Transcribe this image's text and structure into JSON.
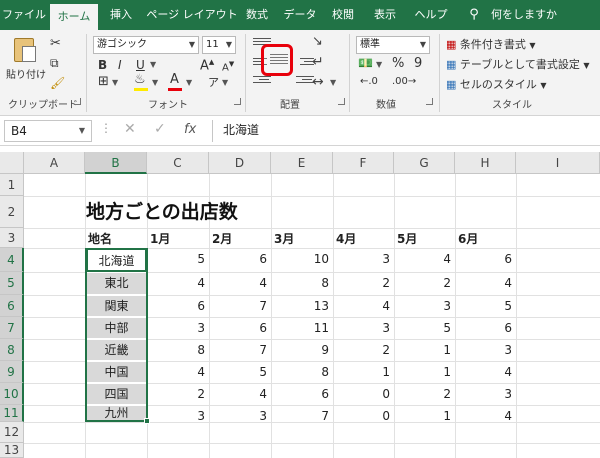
{
  "tabs": [
    {
      "label": "ファイル",
      "active": false
    },
    {
      "label": "ホーム",
      "active": true
    },
    {
      "label": "挿入",
      "active": false
    },
    {
      "label": "ページ レイアウト",
      "active": false
    },
    {
      "label": "数式",
      "active": false
    },
    {
      "label": "データ",
      "active": false
    },
    {
      "label": "校閲",
      "active": false
    },
    {
      "label": "表示",
      "active": false
    },
    {
      "label": "ヘルプ",
      "active": false
    }
  ],
  "tellme": "何をしますか",
  "ribbon": {
    "clipboard": {
      "label": "クリップボード",
      "paste_label": "貼り付け"
    },
    "font": {
      "label": "フォント",
      "font_name": "游ゴシック",
      "font_size": "11",
      "grow": "A",
      "shrink": "A",
      "bold": "B",
      "italic": "I",
      "underline": "U",
      "color_a": "A"
    },
    "alignment": {
      "label": "配置"
    },
    "number": {
      "label": "数値",
      "format": "標準",
      "percent": "%",
      "comma": "9"
    },
    "styles": {
      "label": "スタイル",
      "conditional": "条件付き書式",
      "table": "テーブルとして書式設定",
      "cell_styles": "セルのスタイル"
    }
  },
  "colors": {
    "accent": "#217346",
    "highlight": "#e8000b"
  },
  "namebox": "B4",
  "formula_value": "北海道",
  "fx_label": "fx",
  "columns": [
    "A",
    "B",
    "C",
    "D",
    "E",
    "F",
    "G",
    "H",
    "I"
  ],
  "rows": [
    "1",
    "2",
    "3",
    "4",
    "5",
    "6",
    "7",
    "8",
    "9",
    "10",
    "11",
    "12",
    "13"
  ],
  "sheet": {
    "title": "地方ごとの出店数",
    "header_label": "地名",
    "months": [
      "1月",
      "2月",
      "3月",
      "4月",
      "5月",
      "6月"
    ],
    "regions": [
      "北海道",
      "東北",
      "関東",
      "中部",
      "近畿",
      "中国",
      "四国",
      "九州"
    ],
    "values": [
      [
        "5",
        "6",
        "10",
        "3",
        "4",
        "6"
      ],
      [
        "4",
        "4",
        "8",
        "2",
        "2",
        "4"
      ],
      [
        "6",
        "7",
        "13",
        "4",
        "3",
        "5"
      ],
      [
        "3",
        "6",
        "11",
        "3",
        "5",
        "6"
      ],
      [
        "8",
        "7",
        "9",
        "2",
        "1",
        "3"
      ],
      [
        "4",
        "5",
        "8",
        "1",
        "1",
        "4"
      ],
      [
        "2",
        "4",
        "6",
        "0",
        "2",
        "3"
      ],
      [
        "3",
        "3",
        "7",
        "0",
        "1",
        "4"
      ]
    ]
  }
}
